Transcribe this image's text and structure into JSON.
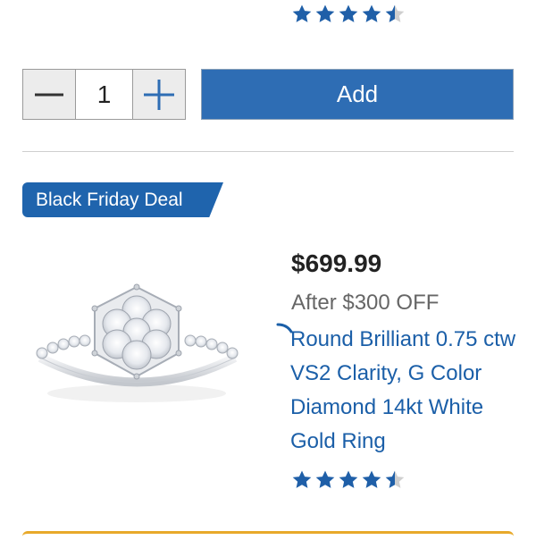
{
  "top_product": {
    "rating": 4.5
  },
  "cart": {
    "quantity": "1",
    "add_label": "Add"
  },
  "product": {
    "badge": "Black Friday Deal",
    "price": "$699.99",
    "discount": "After $300 OFF",
    "title": "Round Brilliant 0.75 ctw VS2 Clarity, G Color Diamond 14kt White Gold Ring",
    "rating": 4.5
  },
  "colors": {
    "accent": "#2e6db4",
    "badge": "#1f64ad",
    "link": "#1b5fa8",
    "star": "#1f5fa8",
    "star_empty": "#cfcfcf",
    "bottom_border": "#e8a92a"
  },
  "icons": {
    "minus": "minus-icon",
    "plus": "plus-icon",
    "star": "star-icon"
  }
}
